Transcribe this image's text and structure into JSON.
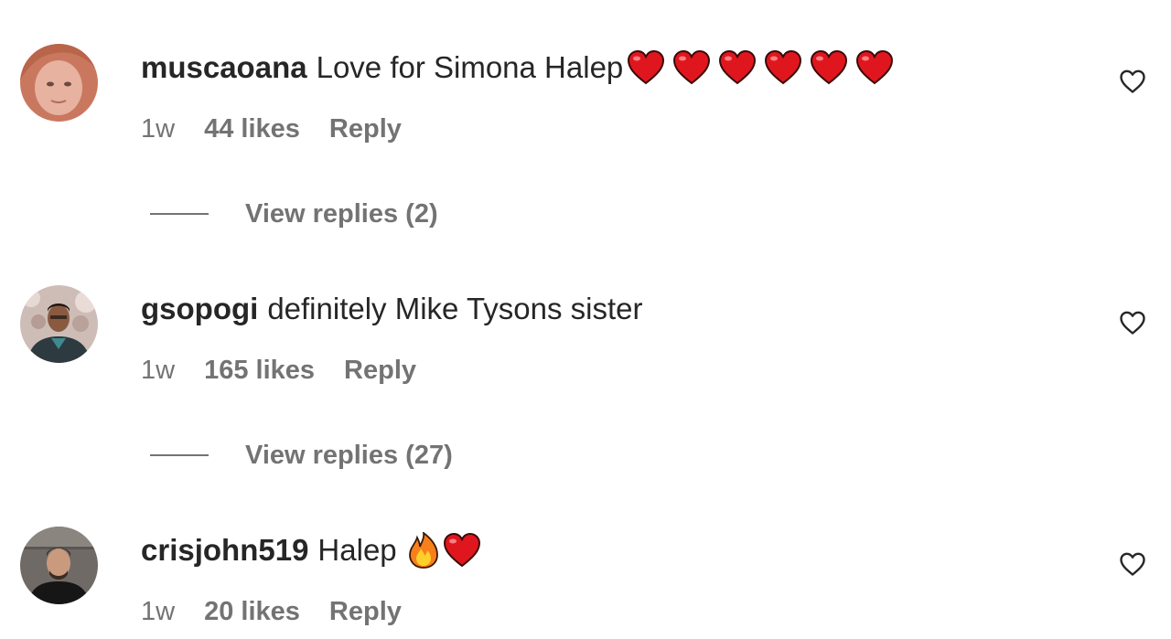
{
  "comments": [
    {
      "username": "muscaoana",
      "text": "Love for Simona Halep",
      "emojis": [
        "red-heart",
        "red-heart",
        "red-heart",
        "red-heart",
        "red-heart",
        "red-heart"
      ],
      "time": "1w",
      "likes": "44 likes",
      "reply_label": "Reply",
      "view_replies": "View replies (2)"
    },
    {
      "username": "gsopogi",
      "text": "definitely Mike Tysons sister",
      "emojis": [],
      "time": "1w",
      "likes": "165 likes",
      "reply_label": "Reply",
      "view_replies": "View replies (27)"
    },
    {
      "username": "crisjohn519",
      "text": "Halep",
      "emojis": [
        "fire",
        "red-heart"
      ],
      "time": "1w",
      "likes": "20 likes",
      "reply_label": "Reply"
    }
  ],
  "icons": {
    "like": "heart-outline-icon"
  },
  "colors": {
    "primary_text": "#262626",
    "secondary_text": "#737373",
    "heart": "#e0161e",
    "fire": "#f77f1c"
  }
}
